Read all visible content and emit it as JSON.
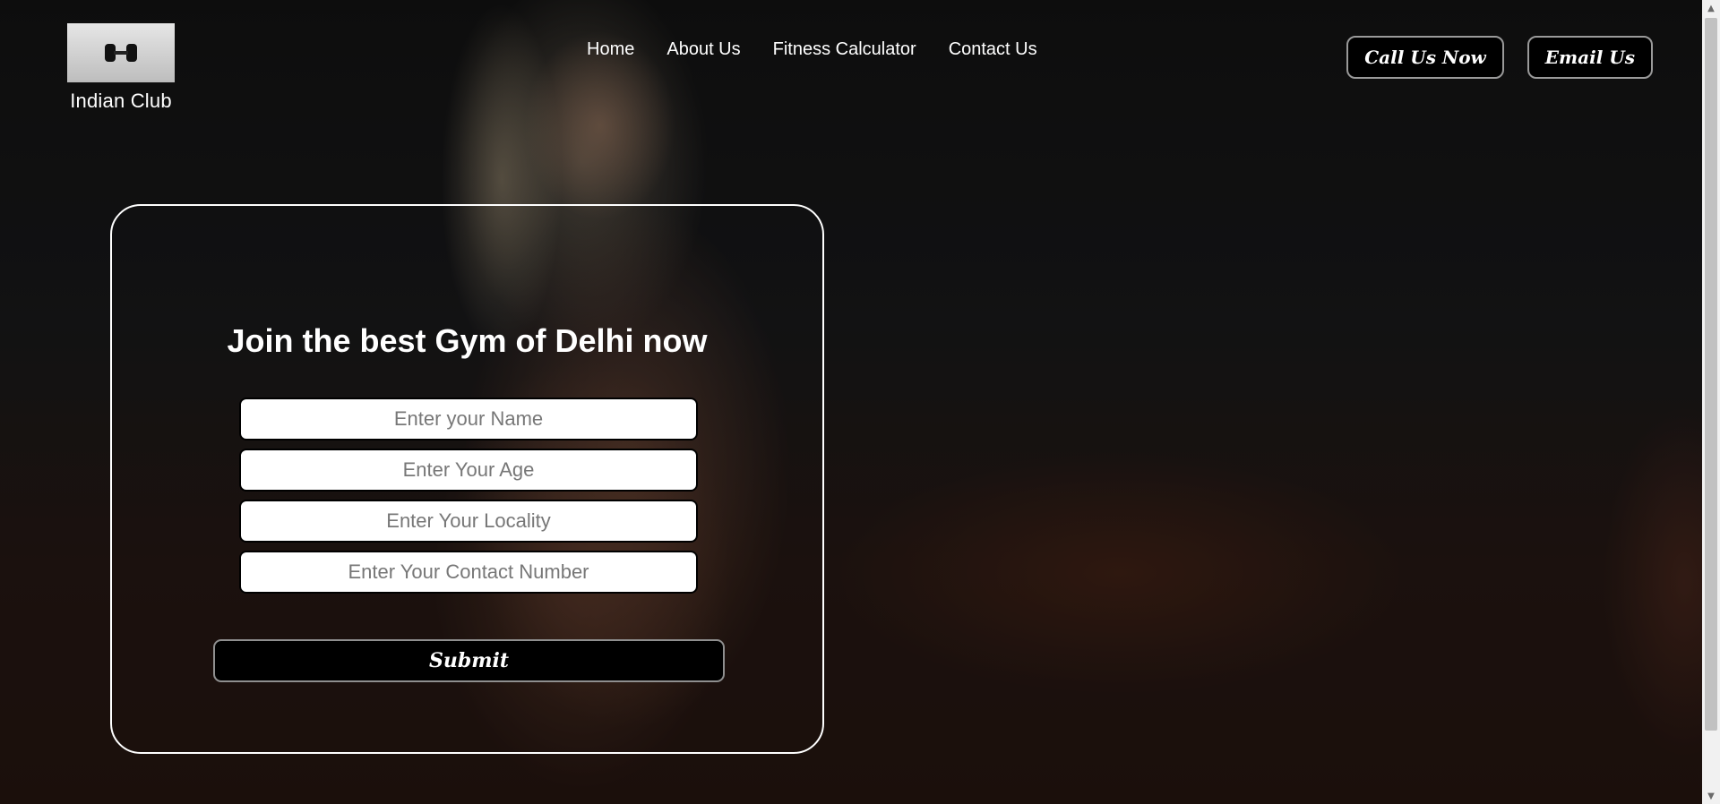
{
  "header": {
    "logo_title": "Indian Club",
    "nav": [
      {
        "label": "Home"
      },
      {
        "label": "About Us"
      },
      {
        "label": "Fitness Calculator"
      },
      {
        "label": "Contact Us"
      }
    ],
    "call_button": "Call Us Now",
    "email_button": "Email Us"
  },
  "form": {
    "title": "Join the best Gym of Delhi now",
    "fields": {
      "name_placeholder": "Enter your Name",
      "age_placeholder": "Enter Your Age",
      "locality_placeholder": "Enter Your Locality",
      "contact_placeholder": "Enter Your Contact Number"
    },
    "submit_label": "Submit"
  },
  "colors": {
    "background": "#101010",
    "button_bg": "#000000",
    "text": "#ffffff",
    "card_border": "#ffffff"
  },
  "icons": {
    "logo": "dumbbell-icon",
    "scroll_up": "scroll-up-arrow-icon",
    "scroll_down": "scroll-down-arrow-icon"
  }
}
